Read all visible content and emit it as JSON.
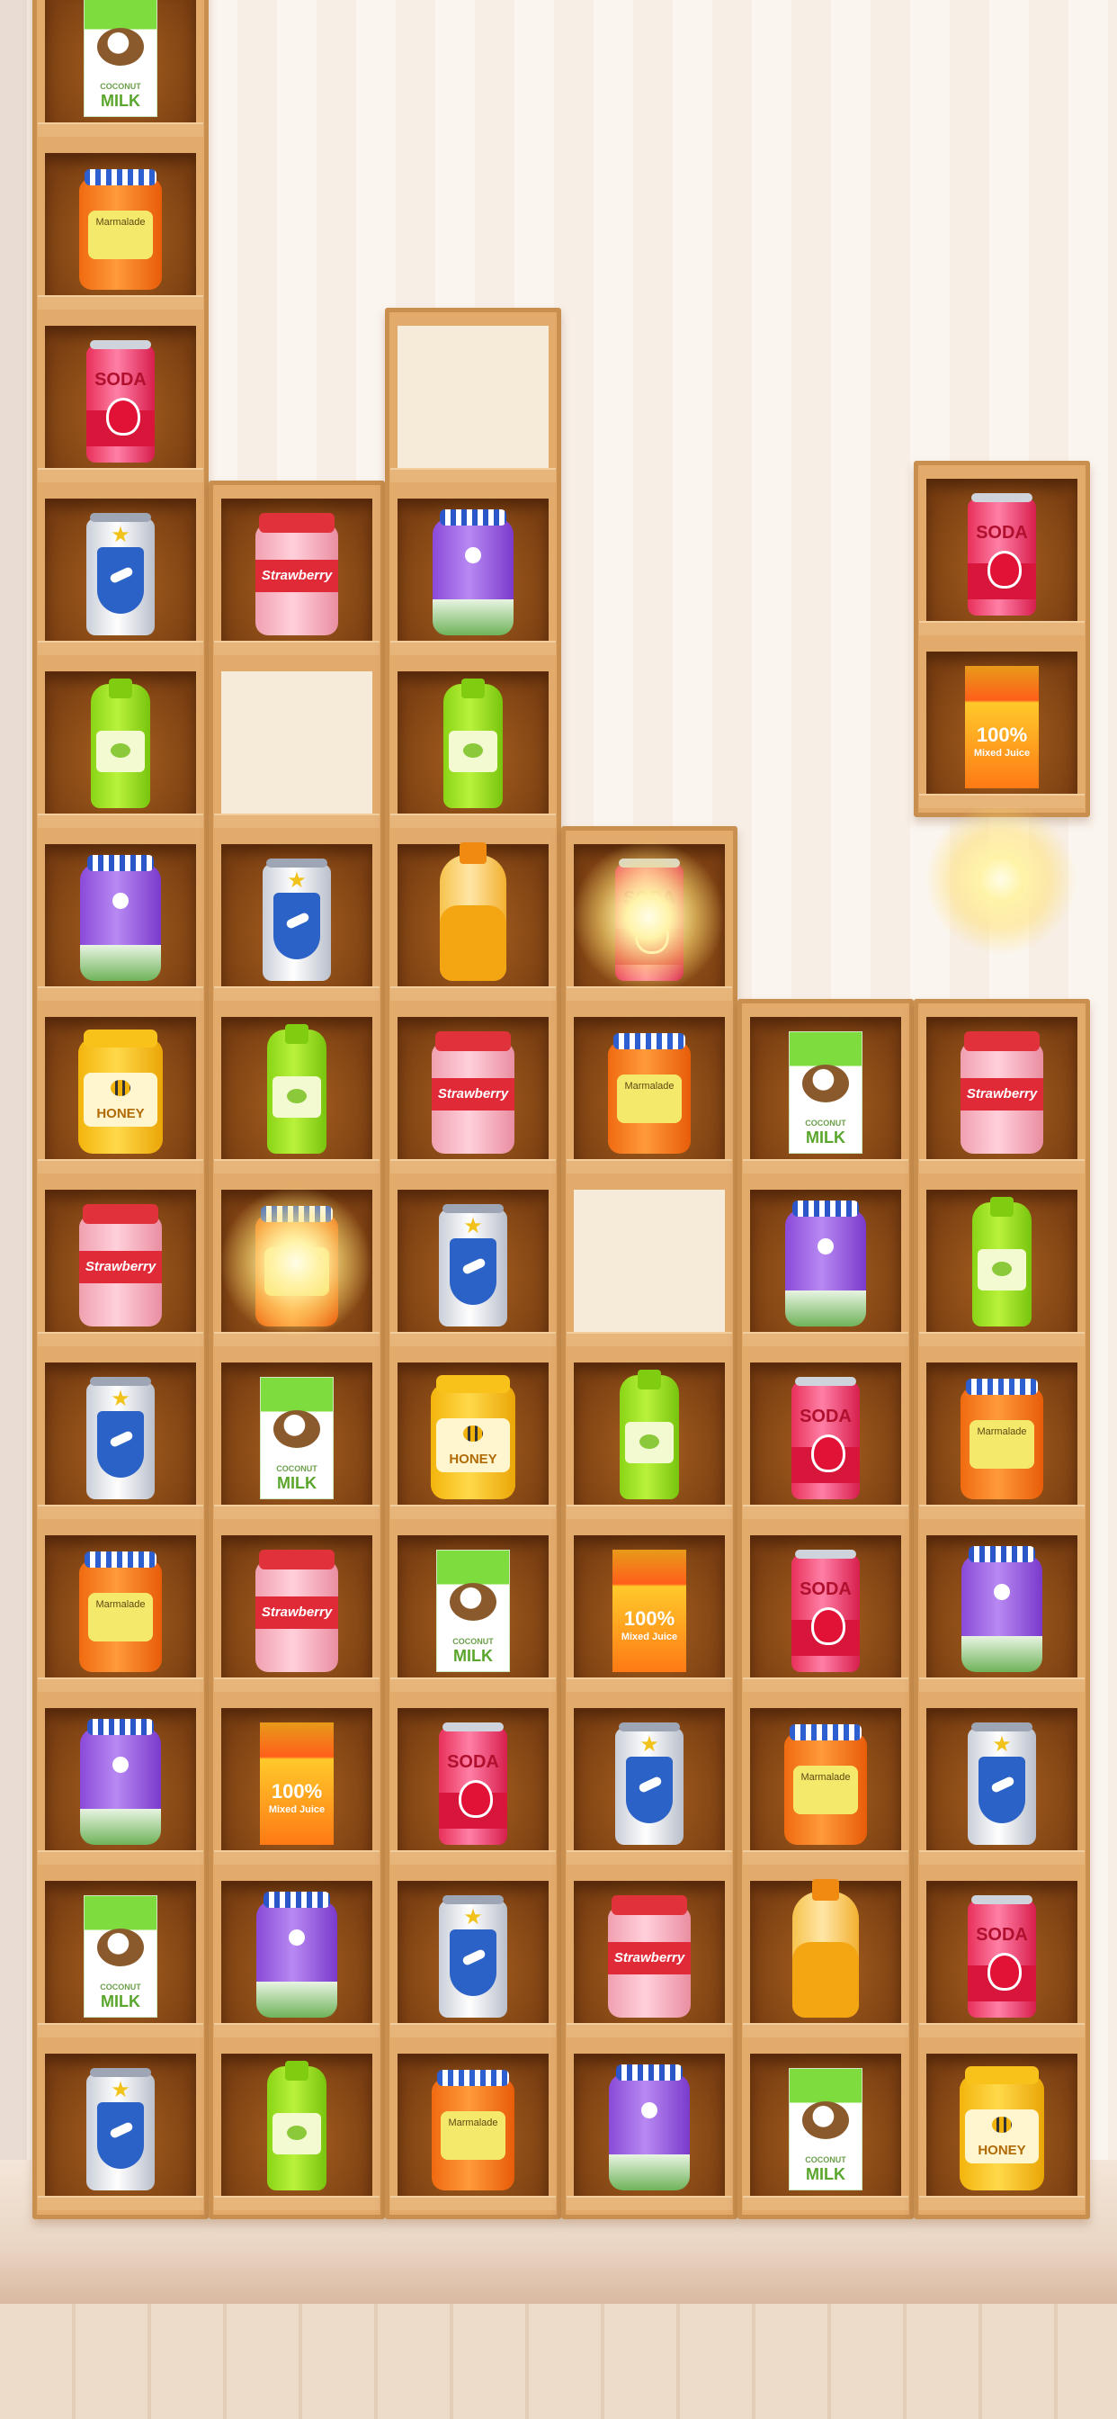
{
  "labels": {
    "soda": "SODA",
    "coconut_small": "COCONUT",
    "coconut_milk": "MILK",
    "marmalade": "Marmalade",
    "strawberry": "Strawberry",
    "honey": "HONEY",
    "juice_pct": "100%",
    "juice_name": "Mixed Juice"
  },
  "board": {
    "columns": 6,
    "column_heights": [
      13,
      10,
      11,
      8,
      7,
      7
    ],
    "sparkle_cells": [
      {
        "col": 1,
        "row": 7
      },
      {
        "col": 3,
        "row": 5
      }
    ],
    "floating_shelf": {
      "col": 5,
      "items": [
        "soda",
        "juice"
      ],
      "sparkle_below": true
    },
    "grid": [
      [
        "cocomilk",
        "marm",
        "soda",
        "shield",
        "greenb",
        "purple",
        "honey",
        "strawb",
        "shield",
        "marm",
        "purple",
        "cocomilk",
        "shield"
      ],
      [
        null,
        null,
        null,
        null,
        "strawb",
        null,
        "shield",
        "greenb",
        "marm",
        "cocomilk",
        "strawb",
        "juice",
        "purple",
        "greenb"
      ],
      [
        null,
        null,
        null,
        "purple",
        "greenb",
        "bottle",
        "strawb",
        "shield",
        "honey",
        "cocomilk",
        "soda",
        "shield",
        "marm"
      ],
      [
        null,
        null,
        null,
        null,
        null,
        null,
        "soda",
        "marm",
        null,
        "greenb",
        "juice",
        "shield",
        "strawb",
        "purple"
      ],
      [
        null,
        null,
        null,
        null,
        null,
        null,
        "cocomilk",
        "purple",
        "soda",
        "soda",
        "marm",
        "bottle",
        "cocomilk"
      ],
      [
        null,
        null,
        null,
        null,
        null,
        null,
        "strawb",
        "greenb",
        "marm",
        "purple",
        "shield",
        "soda",
        "honey"
      ]
    ]
  }
}
